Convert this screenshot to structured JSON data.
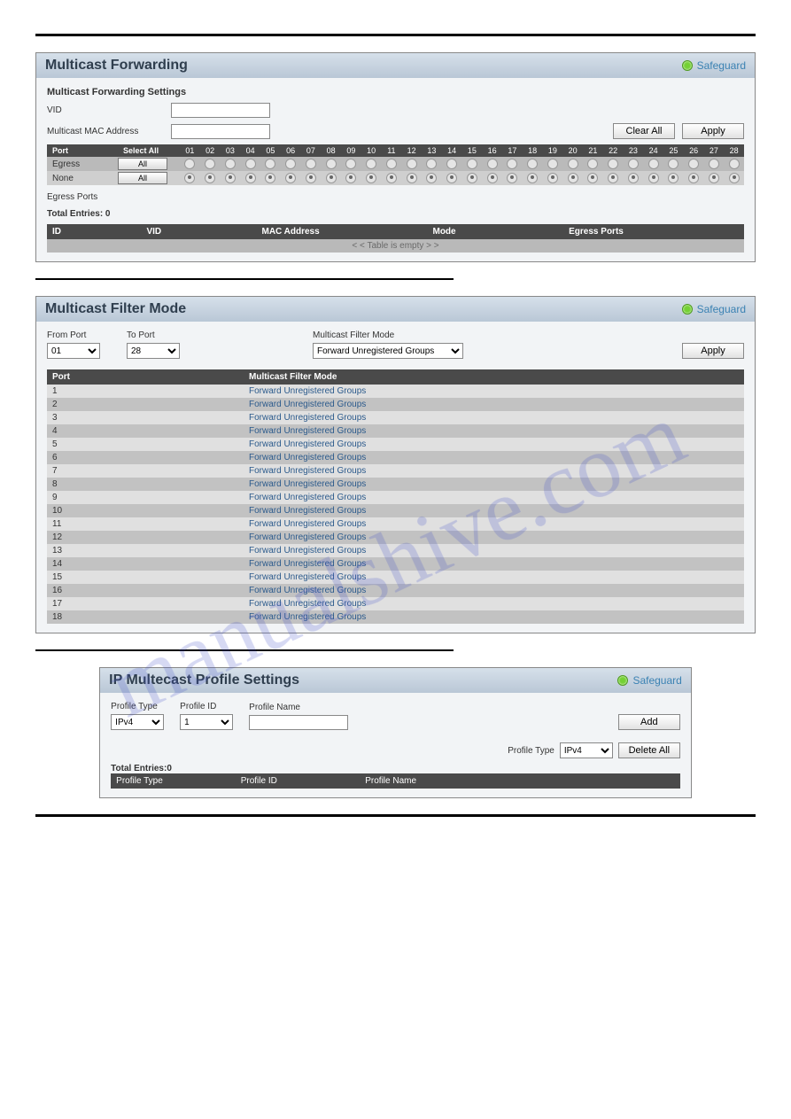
{
  "watermark": "manualshive.com",
  "port_numbers": [
    "01",
    "02",
    "03",
    "04",
    "05",
    "06",
    "07",
    "08",
    "09",
    "10",
    "11",
    "12",
    "13",
    "14",
    "15",
    "16",
    "17",
    "18",
    "19",
    "20",
    "21",
    "22",
    "23",
    "24",
    "25",
    "26",
    "27",
    "28"
  ],
  "panel1": {
    "title": "Multicast Forwarding",
    "safeguard": "Safeguard",
    "sec_label": "Multicast Forwarding Settings",
    "vid_label": "VID",
    "mac_label": "Multicast MAC Address",
    "clear_btn": "Clear All",
    "apply_btn": "Apply",
    "port_hdr": "Port",
    "select_all_hdr": "Select All",
    "rows": [
      {
        "name": "Egress",
        "btn": "All",
        "selected": false
      },
      {
        "name": "None",
        "btn": "All",
        "selected": true
      }
    ],
    "egress_label": "Egress Ports",
    "total_label": "Total Entries: 0",
    "table_cols": {
      "id": "ID",
      "vid": "VID",
      "mac": "MAC Address",
      "mode": "Mode",
      "egress": "Egress Ports"
    },
    "empty_text": "< < Table is empty > >"
  },
  "panel2": {
    "title": "Multicast Filter Mode",
    "safeguard": "Safeguard",
    "from_label": "From Port",
    "to_label": "To Port",
    "from_val": "01",
    "to_val": "28",
    "mode_label": "Multicast Filter Mode",
    "mode_val": "Forward Unregistered Groups",
    "apply_btn": "Apply",
    "col_port": "Port",
    "col_mode": "Multicast Filter Mode",
    "rows": [
      {
        "port": "1",
        "mode": "Forward Unregistered Groups"
      },
      {
        "port": "2",
        "mode": "Forward Unregistered Groups"
      },
      {
        "port": "3",
        "mode": "Forward Unregistered Groups"
      },
      {
        "port": "4",
        "mode": "Forward Unregistered Groups"
      },
      {
        "port": "5",
        "mode": "Forward Unregistered Groups"
      },
      {
        "port": "6",
        "mode": "Forward Unregistered Groups"
      },
      {
        "port": "7",
        "mode": "Forward Unregistered Groups"
      },
      {
        "port": "8",
        "mode": "Forward Unregistered Groups"
      },
      {
        "port": "9",
        "mode": "Forward Unregistered Groups"
      },
      {
        "port": "10",
        "mode": "Forward Unregistered Groups"
      },
      {
        "port": "11",
        "mode": "Forward Unregistered Groups"
      },
      {
        "port": "12",
        "mode": "Forward Unregistered Groups"
      },
      {
        "port": "13",
        "mode": "Forward Unregistered Groups"
      },
      {
        "port": "14",
        "mode": "Forward Unregistered Groups"
      },
      {
        "port": "15",
        "mode": "Forward Unregistered Groups"
      },
      {
        "port": "16",
        "mode": "Forward Unregistered Groups"
      },
      {
        "port": "17",
        "mode": "Forward Unregistered Groups"
      },
      {
        "port": "18",
        "mode": "Forward Unregistered Groups"
      }
    ]
  },
  "panel3": {
    "title": "IP Multecast Profile Settings",
    "safeguard": "Safeguard",
    "ptype_label": "Profile Type",
    "pid_label": "Profile ID",
    "pname_label": "Profile Name",
    "ptype_val": "IPv4",
    "pid_val": "1",
    "add_btn": "Add",
    "del_ptype_label": "Profile Type",
    "del_ptype_val": "IPv4",
    "delall_btn": "Delete All",
    "total_label": "Total Entries:0",
    "cols": {
      "ptype": "Profile Type",
      "pid": "Profile ID",
      "pname": "Profile Name"
    }
  }
}
